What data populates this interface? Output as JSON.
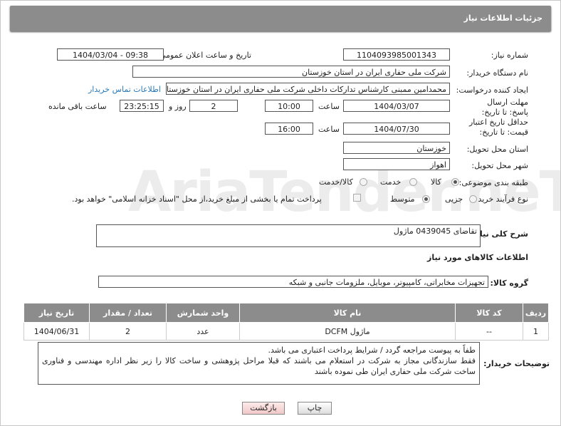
{
  "header": {
    "title": "جزئیات اطلاعات نیاز"
  },
  "fields": {
    "need_number_label": "شماره نیاز:",
    "need_number": "1104093985001343",
    "announce_label": "تاریخ و ساعت اعلان عمومی:",
    "announce_value": "1404/03/04 - 09:38",
    "buyer_org_label": "نام دستگاه خریدار:",
    "buyer_org": "شرکت ملی حفاری ایران در استان خوزستان",
    "creator_label": "ایجاد کننده درخواست:",
    "creator": "محمدامین ممبنی کارشناس تدارکات داخلی شرکت ملی حفاری ایران در استان خوزستان",
    "contact_link": "اطلاعات تماس خریدار",
    "reply_deadline_label": "مهلت ارسال پاسخ: تا تاریخ:",
    "reply_date": "1404/03/07",
    "time_label": "ساعت",
    "reply_time": "10:00",
    "days_value": "2",
    "days_label": "روز و",
    "remaining_time": "23:25:15",
    "remaining_label": "ساعت باقی مانده",
    "price_validity_label": "حداقل تاریخ اعتبار قیمت: تا تاریخ:",
    "price_date": "1404/07/30",
    "price_time_label": "ساعت",
    "price_time": "16:00",
    "province_label": "استان محل تحویل:",
    "province": "خوزستان",
    "city_label": "شهر محل تحویل:",
    "city": "اهواز",
    "category_label": "طبقه بندی موضوعی:",
    "category_options": [
      "کالا",
      "خدمت",
      "کالا/خدمت"
    ],
    "category_selected": "کالا",
    "process_label": "نوع فرآیند خرید :",
    "process_options": [
      "جزیی",
      "متوسط"
    ],
    "process_selected": "متوسط",
    "payment_note": "پرداخت تمام یا بخشی از مبلغ خرید،از محل \"اسناد خزانه اسلامی\" خواهد بود."
  },
  "description": {
    "label": "شرح کلی نیاز:",
    "value": "تقاضای 0439045 ماژول"
  },
  "goods_info_title": "اطلاعات کالاهای مورد نیاز",
  "goods_group": {
    "label": "گروه کالا:",
    "value": "تجهیزات مخابراتی، کامپیوتر، موبایل، ملزومات جانبی و شبکه"
  },
  "table": {
    "headers": [
      "ردیف",
      "کد کالا",
      "نام کالا",
      "واحد شمارش",
      "تعداد / مقدار",
      "تاریخ نیاز"
    ],
    "rows": [
      [
        "1",
        "--",
        "ماژول DCFM",
        "عدد",
        "2",
        "1404/06/31"
      ]
    ]
  },
  "buyer_notes": {
    "label": "توضیحات خریدار:",
    "lines": [
      "طفاً به پیوست مراجعه گردد / شرایط پرداخت اعتباری می باشد.",
      "فقط سازندگانی مجاز به شرکت در استعلام می باشند که قبلا مراحل پژوهشی و ساخت کالا را زیر نظر اداره مهندسی و فناوری ساخت شرکت ملی حفاری ایران طی نموده باشند"
    ]
  },
  "buttons": {
    "print": "چاپ",
    "back": "بازگشت"
  },
  "watermark": "AriaTender.neT"
}
